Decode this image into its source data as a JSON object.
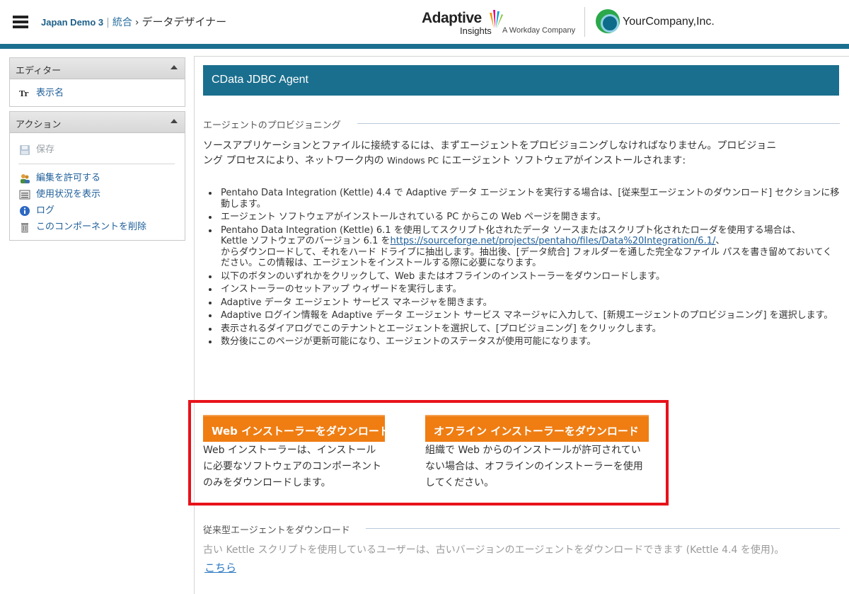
{
  "header": {
    "app_name": "Japan Demo 3",
    "breadcrumb_parent": "統合",
    "breadcrumb_arrow": "›",
    "breadcrumb_current": "データデザイナー",
    "logo_adaptive_word": "Adaptive",
    "logo_adaptive_sub": "Insights",
    "logo_workday": "A Workday Company",
    "logo_yourcompany": "YourCompany,Inc.",
    "accent_color": "#1b6f8e"
  },
  "sidebar": {
    "editor_title": "エディター",
    "editor_items": [
      {
        "label": "表示名",
        "icon": "text-format-icon"
      }
    ],
    "action_title": "アクション",
    "save_label": "保存",
    "action_items": [
      {
        "label": "編集を許可する",
        "icon": "users-icon"
      },
      {
        "label": "使用状況を表示",
        "icon": "usage-report-icon"
      },
      {
        "label": "ログ",
        "icon": "info-icon"
      },
      {
        "label": "このコンポーネントを削除",
        "icon": "trash-icon"
      }
    ]
  },
  "main": {
    "title": "CData JDBC Agent",
    "provisioning_heading": "エージェントのプロビジョニング",
    "intro_line1": "ソースアプリケーションとファイルに接続するには、まずエージェントをプロビジョニングしなければなりません。プロビジョニ",
    "intro_line2_a": "ング プロセスにより、ネットワーク内の ",
    "intro_line2_small": "Windows PC",
    "intro_line2_b": " にエージェント ソフトウェアがインストールされます:",
    "bullets": [
      "Pentaho Data Integration (Kettle) 4.4 で Adaptive データ エージェントを実行する場合は、[従来型エージェントのダウンロード] セクションに移動します。",
      "エージェント ソフトウェアがインストールされている PC からこの Web ページを開きます。",
      "Pentaho Data Integration (Kettle) 6.1 を使用してスクリプト化されたデータ ソースまたはスクリプト化されたローダを使用する場合は、",
      "以下のボタンのいずれかをクリックして、Web またはオフラインのインストーラーをダウンロードします。",
      "インストーラーのセットアップ ウィザードを実行します。",
      "Adaptive データ エージェント サービス マネージャを開きます。",
      "Adaptive ログイン情報を Adaptive データ エージェント サービス マネージャに入力して、[新規エージェントのプロビジョニング] を選択します。",
      "表示されるダイアログでこのテナントとエージェントを選択して、[プロビジョニング] をクリックします。",
      "数分後にこのページが更新可能になり、エージェントのステータスが使用可能になります。"
    ],
    "bullet3_kettle_prefix": "Kettle ソフトウェアのバージョン 6.1 を",
    "bullet3_link": "https://sourceforge.net/projects/pentaho/files/Data%20Integration/6.1/",
    "bullet3_link_suffix": "、",
    "bullet3_rest": "からダウンロードして、それをハード ドライブに抽出します。抽出後、[データ統合] フォルダーを通した完全なファイル パスを書き留めておいてください。この情報は、エージェントをインストールする際に必要になります。",
    "web_button_label": "Web インストーラーをダウンロード",
    "web_desc": "Web インストーラーは、インストールに必要なソフトウェアのコンポーネントのみをダウンロードします。",
    "offline_button_label": "オフライン インストーラーをダウンロード",
    "offline_desc": "組織で Web からのインストールが許可されていない場合は、オフラインのインストーラーを使用してください。",
    "button_color": "#ef7d12",
    "highlight_color": "#e8121a",
    "legacy_heading": "従来型エージェントをダウンロード",
    "legacy_text": "古い Kettle スクリプトを使用しているユーザーは、古いバージョンのエージェントをダウンロードできます (Kettle 4.4 を使用)。",
    "legacy_link": "こちら"
  }
}
